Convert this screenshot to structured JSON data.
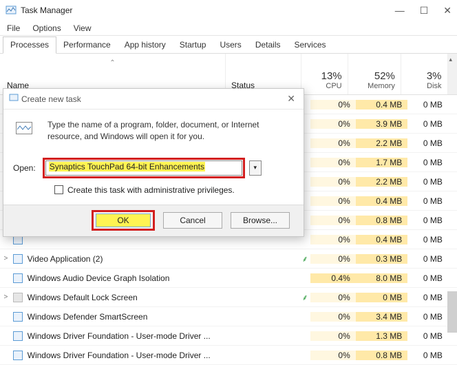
{
  "window": {
    "title": "Task Manager",
    "menu": [
      "File",
      "Options",
      "View"
    ],
    "win_controls": {
      "min": "—",
      "max": "☐",
      "close": "✕"
    }
  },
  "tabs": [
    "Processes",
    "Performance",
    "App history",
    "Startup",
    "Users",
    "Details",
    "Services"
  ],
  "active_tab": 0,
  "columns": {
    "name": "Name",
    "status": "Status",
    "cpu": {
      "pct": "13%",
      "label": "CPU"
    },
    "memory": {
      "pct": "52%",
      "label": "Memory"
    },
    "disk": {
      "pct": "3%",
      "label": "Disk"
    }
  },
  "rows": [
    {
      "expand": "",
      "icon": "blue",
      "name": "",
      "leaf": "",
      "cpu": "0%",
      "mem": "0.4 MB",
      "disk": "0 MB"
    },
    {
      "expand": "",
      "icon": "blue",
      "name": "",
      "leaf": "",
      "cpu": "0%",
      "mem": "3.9 MB",
      "disk": "0 MB"
    },
    {
      "expand": "",
      "icon": "blue",
      "name": "",
      "leaf": "",
      "cpu": "0%",
      "mem": "2.2 MB",
      "disk": "0 MB"
    },
    {
      "expand": "",
      "icon": "blue",
      "name": "",
      "leaf": "",
      "cpu": "0%",
      "mem": "1.7 MB",
      "disk": "0 MB"
    },
    {
      "expand": "",
      "icon": "blue",
      "name": "",
      "leaf": "",
      "cpu": "0%",
      "mem": "2.2 MB",
      "disk": "0 MB"
    },
    {
      "expand": "",
      "icon": "blue",
      "name": "",
      "leaf": "",
      "cpu": "0%",
      "mem": "0.4 MB",
      "disk": "0 MB"
    },
    {
      "expand": "",
      "icon": "blue",
      "name": "",
      "leaf": "",
      "cpu": "0%",
      "mem": "0.8 MB",
      "disk": "0 MB"
    },
    {
      "expand": "",
      "icon": "blue",
      "name": "",
      "leaf": "",
      "cpu": "0%",
      "mem": "0.4 MB",
      "disk": "0 MB"
    },
    {
      "expand": ">",
      "icon": "blue",
      "name": "Video Application (2)",
      "leaf": "leaf",
      "cpu": "0%",
      "mem": "0.3 MB",
      "disk": "0 MB"
    },
    {
      "expand": "",
      "icon": "blue",
      "name": "Windows Audio Device Graph Isolation",
      "leaf": "",
      "cpu": "0.4%",
      "mem": "8.0 MB",
      "disk": "0 MB",
      "cpu_hot": true
    },
    {
      "expand": ">",
      "icon": "gray",
      "name": "Windows Default Lock Screen",
      "leaf": "leaf",
      "cpu": "0%",
      "mem": "0 MB",
      "disk": "0 MB"
    },
    {
      "expand": "",
      "icon": "blue",
      "name": "Windows Defender SmartScreen",
      "leaf": "",
      "cpu": "0%",
      "mem": "3.4 MB",
      "disk": "0 MB"
    },
    {
      "expand": "",
      "icon": "blue",
      "name": "Windows Driver Foundation - User-mode Driver ...",
      "leaf": "",
      "cpu": "0%",
      "mem": "1.3 MB",
      "disk": "0 MB"
    },
    {
      "expand": "",
      "icon": "blue",
      "name": "Windows Driver Foundation - User-mode Driver ...",
      "leaf": "",
      "cpu": "0%",
      "mem": "0.8 MB",
      "disk": "0 MB"
    }
  ],
  "dialog": {
    "title": "Create new task",
    "description": "Type the name of a program, folder, document, or Internet resource, and Windows will open it for you.",
    "open_label": "Open:",
    "open_value": "Synaptics TouchPad 64-bit Enhancements",
    "admin_label": "Create this task with administrative privileges.",
    "admin_checked": false,
    "buttons": {
      "ok": "OK",
      "cancel": "Cancel",
      "browse": "Browse..."
    }
  }
}
